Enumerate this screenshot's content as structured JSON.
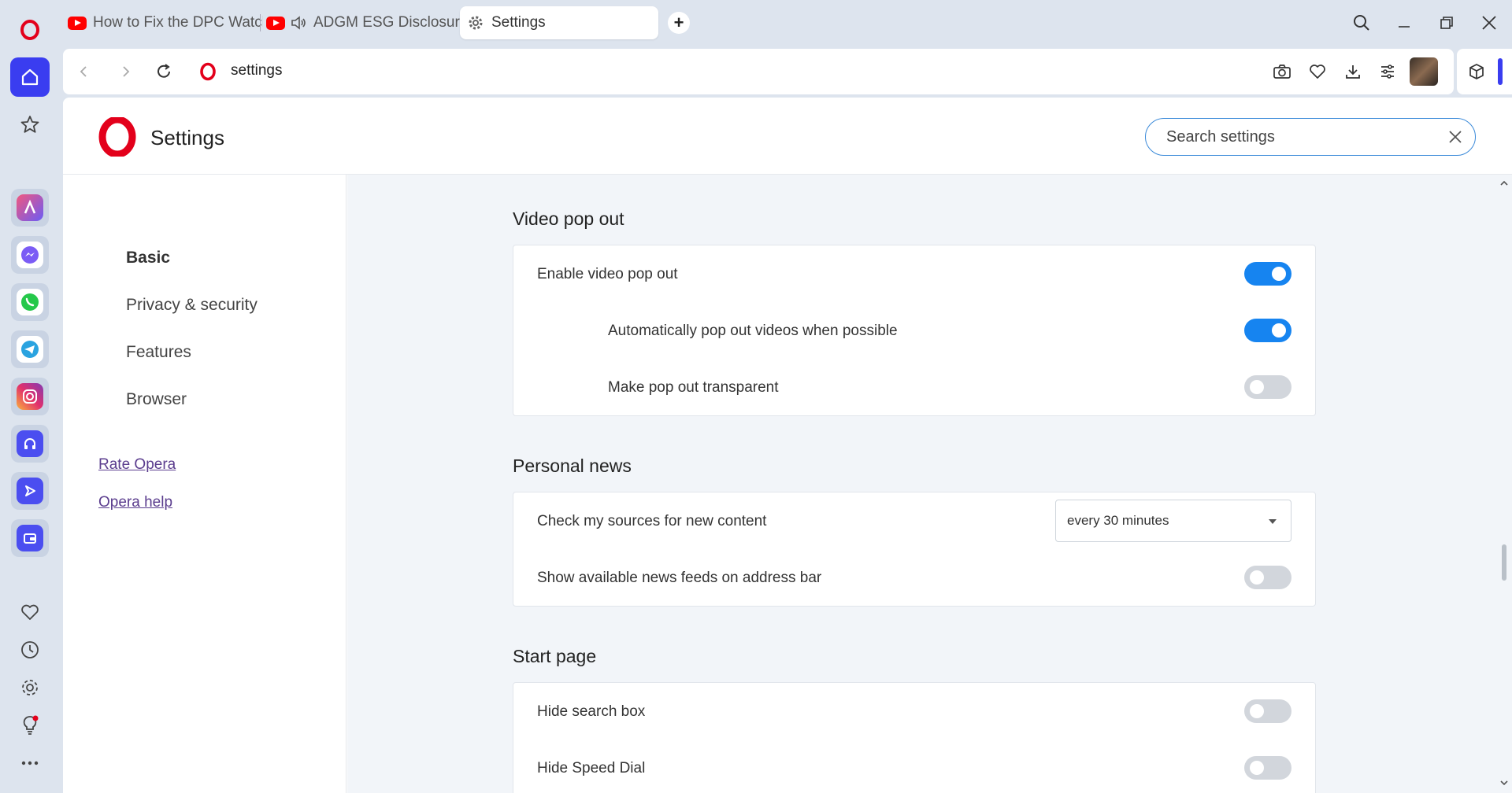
{
  "tabs": [
    {
      "title": "How to Fix the DPC Watchdog",
      "icon": "youtube-icon",
      "audio": false
    },
    {
      "title": "ADGM ESG Disclosures",
      "icon": "youtube-icon",
      "audio": true
    },
    {
      "title": "Settings",
      "icon": "gear-icon",
      "active": true
    }
  ],
  "address": {
    "url": "settings"
  },
  "settings": {
    "title": "Settings",
    "search_placeholder": "Search settings"
  },
  "nav": {
    "items": [
      "Basic",
      "Privacy & security",
      "Features",
      "Browser"
    ],
    "active": "Basic",
    "links": [
      "Rate Opera",
      "Opera help"
    ]
  },
  "sections": {
    "video": {
      "title": "Video pop out",
      "rows": [
        {
          "label": "Enable video pop out",
          "on": true
        },
        {
          "label": "Automatically pop out videos when possible",
          "on": true
        },
        {
          "label": "Make pop out transparent",
          "on": false
        }
      ]
    },
    "news": {
      "title": "Personal news",
      "check_label": "Check my sources for new content",
      "check_value": "every 30 minutes",
      "feeds_label": "Show available news feeds on address bar",
      "feeds_on": false
    },
    "start": {
      "title": "Start page",
      "rows": [
        {
          "label": "Hide search box",
          "on": false
        },
        {
          "label": "Hide Speed Dial",
          "on": false
        }
      ]
    }
  },
  "colors": {
    "accent": "#1684f0",
    "opera_red": "#e3001b",
    "sidebar_active": "#3a3df0"
  }
}
